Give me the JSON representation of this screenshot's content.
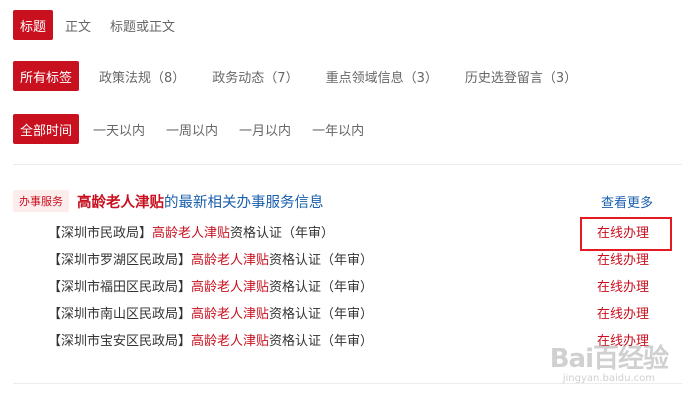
{
  "filters": {
    "field": {
      "options": [
        {
          "label": "标题",
          "active": true
        },
        {
          "label": "正文",
          "active": false
        },
        {
          "label": "标题或正文",
          "active": false
        }
      ]
    },
    "tags": {
      "options": [
        {
          "label": "所有标签",
          "active": true
        },
        {
          "label": "政策法规（8）",
          "active": false
        },
        {
          "label": "政务动态（7）",
          "active": false
        },
        {
          "label": "重点领域信息（3）",
          "active": false
        },
        {
          "label": "历史选登留言（3）",
          "active": false
        }
      ]
    },
    "time": {
      "options": [
        {
          "label": "全部时间",
          "active": true
        },
        {
          "label": "一天以内",
          "active": false
        },
        {
          "label": "一周以内",
          "active": false
        },
        {
          "label": "一月以内",
          "active": false
        },
        {
          "label": "一年以内",
          "active": false
        }
      ]
    }
  },
  "service": {
    "badge": "办事服务",
    "keyword": "高龄老人津贴",
    "heading_suffix": "的最新相关办事服务信息",
    "more_link": "查看更多",
    "items": [
      {
        "dept": "【深圳市民政局】",
        "keyword": "高龄老人津贴",
        "rest": "资格认证（年审）",
        "action": "在线办理",
        "highlighted": true
      },
      {
        "dept": "【深圳市罗湖区民政局】",
        "keyword": "高龄老人津贴",
        "rest": "资格认证（年审）",
        "action": "在线办理",
        "highlighted": false
      },
      {
        "dept": "【深圳市福田区民政局】",
        "keyword": "高龄老人津贴",
        "rest": "资格认证（年审）",
        "action": "在线办理",
        "highlighted": false
      },
      {
        "dept": "【深圳市南山区民政局】",
        "keyword": "高龄老人津贴",
        "rest": "资格认证（年审）",
        "action": "在线办理",
        "highlighted": false
      },
      {
        "dept": "【深圳市宝安区民政局】",
        "keyword": "高龄老人津贴",
        "rest": "资格认证（年审）",
        "action": "在线办理",
        "highlighted": false
      }
    ]
  },
  "watermark": {
    "logo": "Bai百经验",
    "sub": "jingyan.baidu.com"
  },
  "colors": {
    "accent_red": "#c8101f",
    "link_blue": "#1a5fae",
    "highlight_box": "#e31a22"
  }
}
